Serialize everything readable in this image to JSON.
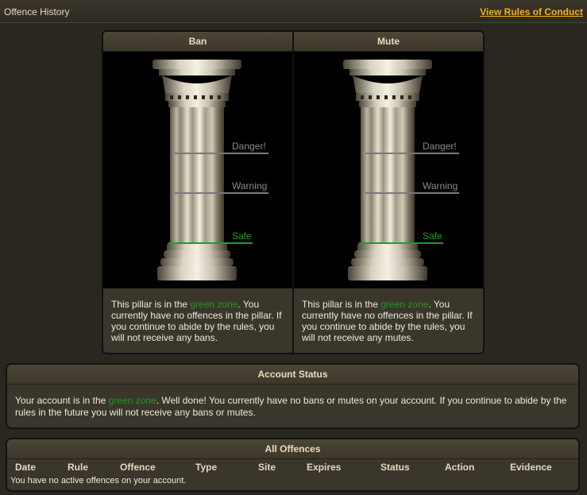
{
  "header": {
    "title": "Offence History",
    "rules_link": "View Rules of Conduct"
  },
  "pillars": [
    {
      "title": "Ban",
      "levels": [
        "Danger!",
        "Warning",
        "Safe"
      ],
      "text_before": "This pillar is in the ",
      "zone": "green zone",
      "text_after": ". You currently have no offences in the pillar. If you continue to abide by the rules, you will not receive any bans."
    },
    {
      "title": "Mute",
      "levels": [
        "Danger!",
        "Warning",
        "Safe"
      ],
      "text_before": "This pillar is in the ",
      "zone": "green zone",
      "text_after": ". You currently have no offences in the pillar. If you continue to abide by the rules, you will not receive any mutes."
    }
  ],
  "account_status": {
    "title": "Account Status",
    "text_before": "Your account is in the ",
    "zone": "green zone",
    "text_after": ". Well done! You currently have no bans or mutes on your account. If you continue to abide by the rules in the future you will not receive any bans or mutes."
  },
  "offences": {
    "title": "All Offences",
    "columns": [
      "Date",
      "Rule",
      "Offence",
      "Type",
      "Site",
      "Expires",
      "Status",
      "Action",
      "Evidence"
    ],
    "empty_message": "You have no active offences on your account."
  },
  "colors": {
    "accent_link": "#f0b020",
    "green_zone": "#1e9a1e",
    "background": "#2a2720"
  }
}
